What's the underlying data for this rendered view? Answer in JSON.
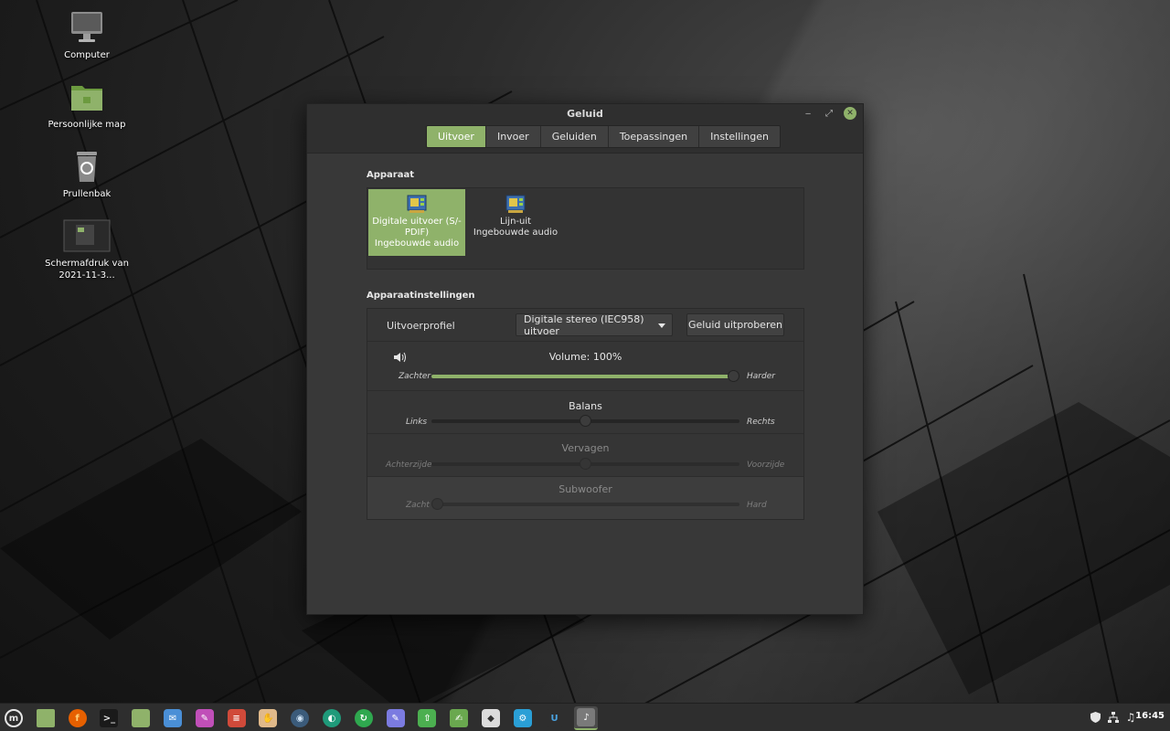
{
  "desktop": {
    "icons": [
      {
        "label": "Computer"
      },
      {
        "label": "Persoonlijke map"
      },
      {
        "label": "Prullenbak"
      },
      {
        "label": "Schermafdruk van 2021-11-3..."
      }
    ]
  },
  "window": {
    "title": "Geluid",
    "tabs": [
      {
        "label": "Uitvoer",
        "active": true
      },
      {
        "label": "Invoer"
      },
      {
        "label": "Geluiden"
      },
      {
        "label": "Toepassingen"
      },
      {
        "label": "Instellingen"
      }
    ],
    "device_section": {
      "heading": "Apparaat",
      "devices": [
        {
          "name": "Digitale uitvoer (S/-PDIF)",
          "sub": "Ingebouwde audio",
          "selected": true
        },
        {
          "name": "Lijn-uit",
          "sub": "Ingebouwde audio"
        }
      ]
    },
    "settings_section": {
      "heading": "Apparaatinstellingen",
      "profile_label": "Uitvoerprofiel",
      "profile_value": "Digitale stereo (IEC958) uitvoer",
      "test_button": "Geluid uitproberen",
      "volume": {
        "title": "Volume: 100%",
        "left": "Zachter",
        "right": "Harder",
        "value": 1.0
      },
      "balance": {
        "title": "Balans",
        "left": "Links",
        "right": "Rechts",
        "value": 0.5
      },
      "fade": {
        "title": "Vervagen",
        "left": "Achterzijde",
        "right": "Voorzijde",
        "value": 0.5
      },
      "subwoofer": {
        "title": "Subwoofer",
        "left": "Zacht",
        "right": "Hard",
        "value": 0.0
      }
    }
  },
  "taskbar": {
    "clock": "16:45",
    "accent": "#8fb26a",
    "apps": [
      {
        "icon": "mint-menu-icon"
      },
      {
        "icon": "show-desktop-icon"
      },
      {
        "icon": "firefox-icon"
      },
      {
        "icon": "terminal-icon"
      },
      {
        "icon": "files-icon"
      },
      {
        "icon": "mail-icon"
      },
      {
        "icon": "drawing-icon"
      },
      {
        "icon": "calculator-icon"
      },
      {
        "icon": "pinta-icon"
      },
      {
        "icon": "browser-icon"
      },
      {
        "icon": "inkscape-icon"
      },
      {
        "icon": "refresh-icon"
      },
      {
        "icon": "notes-icon"
      },
      {
        "icon": "update-manager-icon"
      },
      {
        "icon": "text-editor-icon"
      },
      {
        "icon": "software-icon"
      },
      {
        "icon": "settings-icon"
      },
      {
        "icon": "u-app-icon"
      },
      {
        "icon": "sound-settings-icon"
      }
    ],
    "tray": [
      {
        "icon": "shield-icon"
      },
      {
        "icon": "network-icon"
      },
      {
        "icon": "music-note-icon"
      }
    ]
  }
}
